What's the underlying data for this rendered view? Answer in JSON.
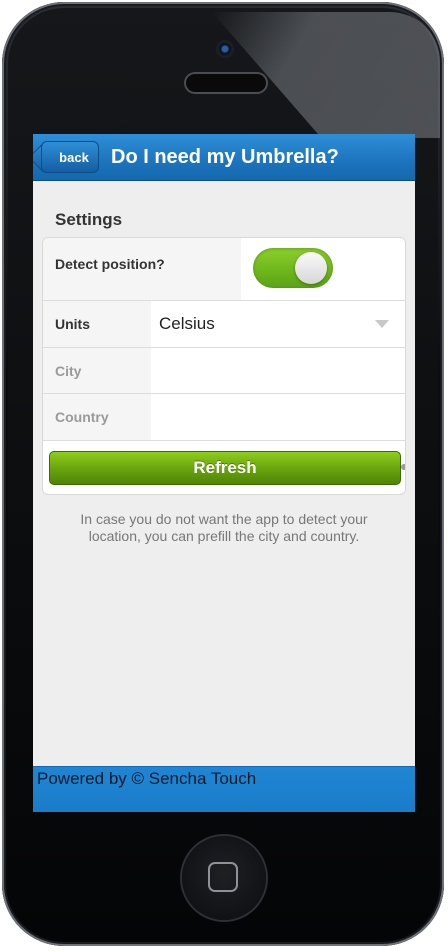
{
  "app": {
    "title": "Do I need my Umbrella?",
    "back_label": "back"
  },
  "settings": {
    "section_title": "Settings",
    "detect_position": {
      "label": "Detect position?",
      "enabled": true
    },
    "units": {
      "label": "Units",
      "value": "Celsius"
    },
    "city": {
      "label": "City",
      "value": ""
    },
    "country": {
      "label": "Country",
      "value": ""
    },
    "refresh_label": "Refresh",
    "hint": "In case you do not want the app to detect your location, you can prefill the city and country."
  },
  "footer": {
    "text": "Powered by © Sencha Touch"
  },
  "colors": {
    "titlebar": "#1e76bf",
    "toggle_on": "#7ac21f",
    "refresh": "#6aa60e",
    "background": "#eeeeee"
  }
}
